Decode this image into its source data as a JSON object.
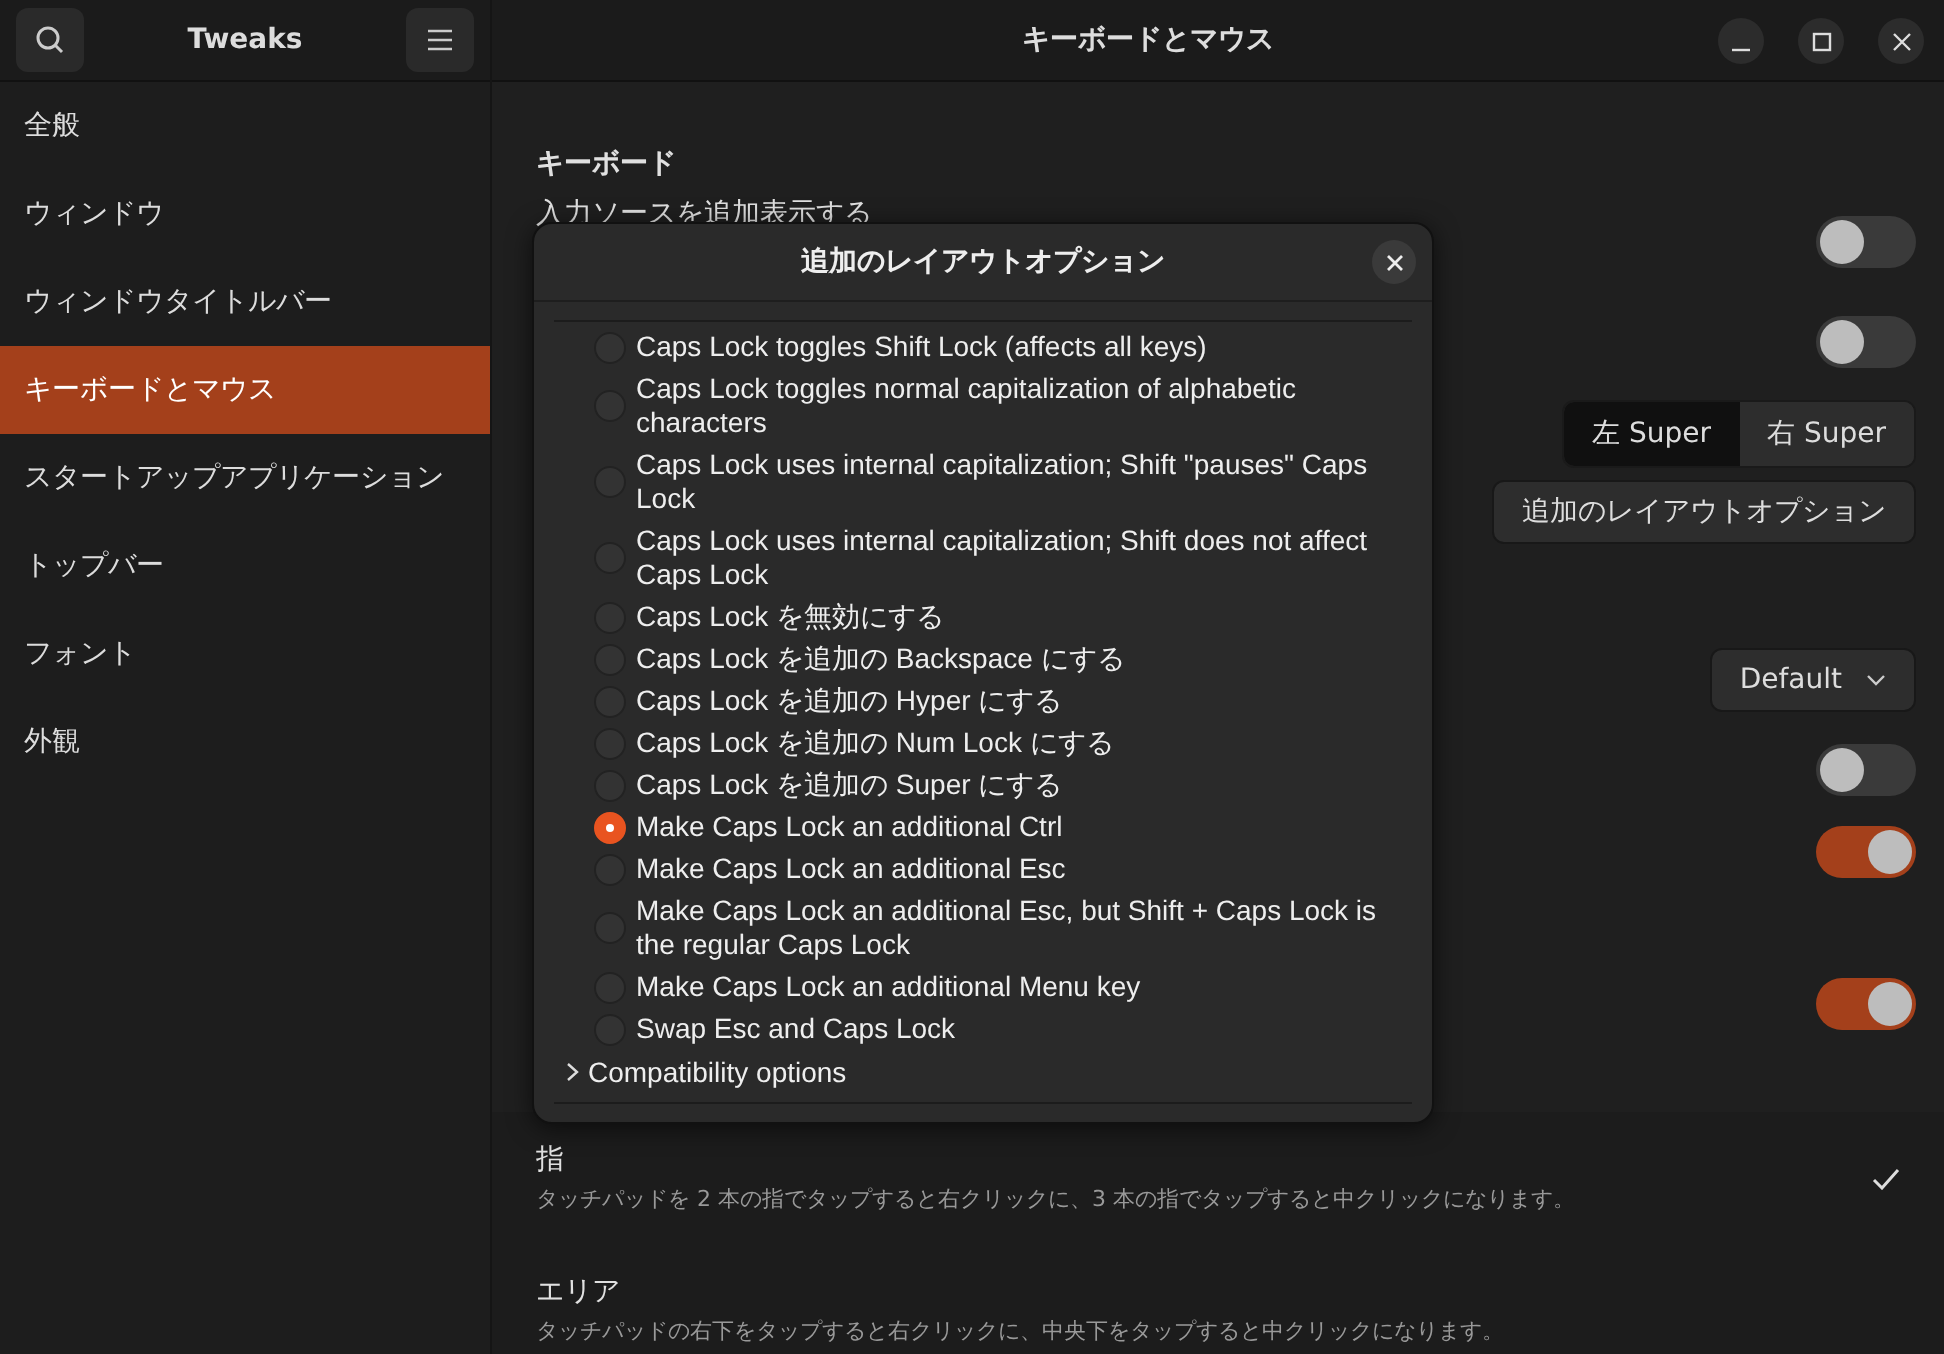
{
  "window": {
    "title": "キーボードとマウス"
  },
  "sidebar": {
    "title": "Tweaks",
    "items": [
      {
        "label": "全般",
        "selected": false
      },
      {
        "label": "ウィンドウ",
        "selected": false
      },
      {
        "label": "ウィンドウタイトルバー",
        "selected": false
      },
      {
        "label": "キーボードとマウス",
        "selected": true
      },
      {
        "label": "スタートアップアプリケーション",
        "selected": false
      },
      {
        "label": "トップバー",
        "selected": false
      },
      {
        "label": "フォント",
        "selected": false
      },
      {
        "label": "外観",
        "selected": false
      }
    ]
  },
  "main": {
    "section_title": "キーボード",
    "rows": [
      {
        "kind": "toggle",
        "label": "入力ソースを追加表示する",
        "on": false
      },
      {
        "kind": "toggle",
        "on": false
      },
      {
        "kind": "segmented",
        "options": [
          {
            "label": "左 Super",
            "selected": true
          },
          {
            "label": "右 Super",
            "selected": false
          }
        ]
      },
      {
        "kind": "button",
        "label": "追加のレイアウトオプション"
      },
      {
        "kind": "dropdown",
        "value": "Default"
      },
      {
        "kind": "toggle",
        "on": false
      },
      {
        "kind": "toggle",
        "on": true
      },
      {
        "kind": "toggle",
        "on": true
      }
    ],
    "click_methods": [
      {
        "title": "指",
        "description": "タッチパッドを 2 本の指でタップすると右クリックに、3 本の指でタップすると中クリックになります。",
        "selected": true
      },
      {
        "title": "エリア",
        "description": "タッチパッドの右下をタップすると右クリックに、中央下をタップすると中クリックになります。",
        "selected": false
      }
    ]
  },
  "dialog": {
    "title": "追加のレイアウトオプション",
    "options": [
      {
        "label": "Caps Lock toggles Shift Lock (affects all keys)",
        "selected": false
      },
      {
        "label": "Caps Lock toggles normal capitalization of alphabetic characters",
        "selected": false
      },
      {
        "label": "Caps Lock uses internal capitalization; Shift \"pauses\" Caps Lock",
        "selected": false
      },
      {
        "label": "Caps Lock uses internal capitalization; Shift does not affect Caps Lock",
        "selected": false
      },
      {
        "label": "Caps Lock を無効にする",
        "selected": false
      },
      {
        "label": "Caps Lock を追加の Backspace にする",
        "selected": false
      },
      {
        "label": "Caps Lock を追加の Hyper にする",
        "selected": false
      },
      {
        "label": "Caps Lock を追加の Num Lock にする",
        "selected": false
      },
      {
        "label": "Caps Lock を追加の Super にする",
        "selected": false
      },
      {
        "label": "Make Caps Lock an additional Ctrl",
        "selected": true
      },
      {
        "label": "Make Caps Lock an additional Esc",
        "selected": false
      },
      {
        "label": "Make Caps Lock an additional Esc, but Shift + Caps Lock is the regular Caps Lock",
        "selected": false
      },
      {
        "label": "Make Caps Lock an additional Menu key",
        "selected": false
      },
      {
        "label": "Swap Esc and Caps Lock",
        "selected": false
      }
    ],
    "group": {
      "label": "Compatibility options",
      "expanded": false
    }
  }
}
